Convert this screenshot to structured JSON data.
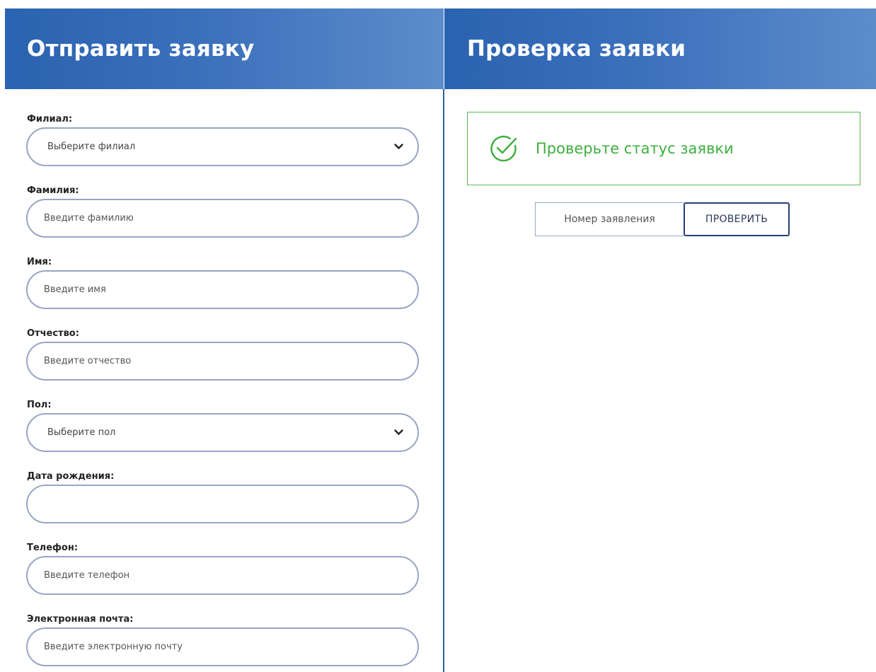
{
  "submit_panel": {
    "title": "Отправить заявку",
    "fields": [
      {
        "label": "Филиал:",
        "type": "select",
        "value": "Выберите филиал",
        "icon": "chevron-down-icon"
      },
      {
        "label": "Фамилия:",
        "type": "text",
        "placeholder": "Введите фамилию"
      },
      {
        "label": "Имя:",
        "type": "text",
        "placeholder": "Введите имя"
      },
      {
        "label": "Отчество:",
        "type": "text",
        "placeholder": "Введите отчество"
      },
      {
        "label": "Пол:",
        "type": "select",
        "value": "Выберите пол",
        "icon": "chevron-down-icon"
      },
      {
        "label": "Дата рождения:",
        "type": "date",
        "value": ""
      },
      {
        "label": "Телефон:",
        "type": "text",
        "placeholder": "Введите телефон"
      },
      {
        "label": "Электронная почта:",
        "type": "text",
        "placeholder": "Введите электронную почту"
      }
    ]
  },
  "check_panel": {
    "title": "Проверка заявки",
    "status_message": "Проверьте статус заявки",
    "status_icon": "check-circle-icon",
    "number_input": {
      "placeholder": "Номер заявления"
    },
    "check_button_label": "ПРОВЕРИТЬ"
  },
  "colors": {
    "header_start": "#2a63b1",
    "header_end": "#5d8ccb",
    "field_border": "#97a5c6",
    "success_green": "#3eae3e",
    "button_border": "#253d78"
  }
}
